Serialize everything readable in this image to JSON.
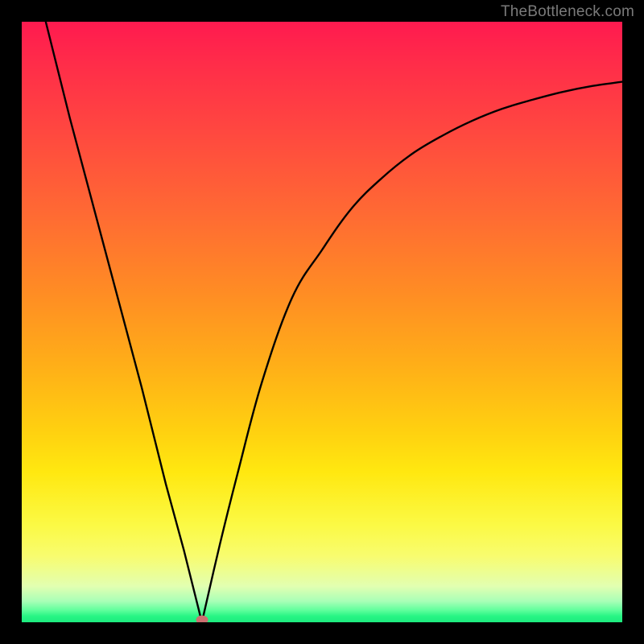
{
  "watermark": "TheBottleneck.com",
  "chart_data": {
    "type": "line",
    "title": "",
    "xlabel": "",
    "ylabel": "",
    "xlim": [
      0,
      100
    ],
    "ylim": [
      0,
      100
    ],
    "grid": false,
    "legend": false,
    "background_gradient": {
      "top_color": "#ff1a4f",
      "mid_color": "#ffd010",
      "bottom_color": "#1deb7f"
    },
    "series": [
      {
        "name": "bottleneck-curve",
        "x": [
          4,
          8,
          12,
          16,
          20,
          24,
          27,
          30,
          33,
          36,
          40,
          45,
          50,
          55,
          60,
          65,
          70,
          75,
          80,
          85,
          90,
          95,
          100
        ],
        "y": [
          100,
          84,
          69,
          54,
          39,
          23,
          12,
          0,
          13,
          25,
          40,
          54,
          62,
          69,
          74,
          78,
          81,
          83.5,
          85.5,
          87,
          88.3,
          89.3,
          90
        ]
      }
    ],
    "marker": {
      "x": 30,
      "y": 0,
      "color": "#cc6f70"
    }
  }
}
